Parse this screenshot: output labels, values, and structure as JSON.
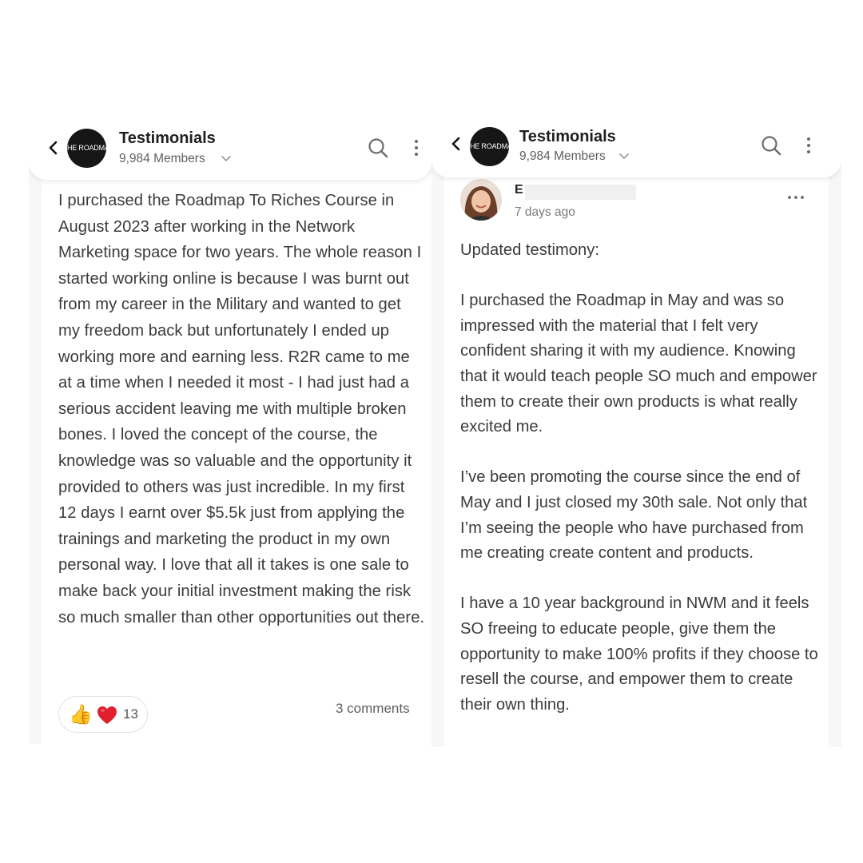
{
  "left": {
    "header": {
      "title": "Testimonials",
      "members": "9,984 Members",
      "logo_text": "HE ROADMA"
    },
    "post": {
      "body": "I purchased the Roadmap To Riches Course in August 2023 after working in the Network Marketing space for two years. The whole reason I started working online is because I was burnt out from my career in the Military and wanted to get my freedom back but unfortunately I ended up working more and earning less. R2R came to me at a time when I needed it most - I had just had a serious accident leaving me with multiple broken bones. I loved the concept of the course, the knowledge was so valuable and the opportunity it provided to others was just incredible. In my first 12 days I earnt over $5.5k just from applying the trainings and marketing the product in my own personal way. I love that all it takes is one sale to make back your initial investment making the risk so much smaller than other opportunities out there.",
      "reaction_icons": [
        "thumbs-up-icon",
        "heart-icon"
      ],
      "reaction_count": "13",
      "comments": "3 comments"
    }
  },
  "right": {
    "header": {
      "title": "Testimonials",
      "members": "9,984 Members",
      "logo_text": "HE ROADMA"
    },
    "post": {
      "author_visible": "E",
      "time": "7 days ago",
      "paragraphs": [
        "Updated testimony:",
        "I purchased the Roadmap in May and was so impressed with the material that I felt very confident sharing it with my audience. Knowing that it would teach people SO much and empower them to create their own products is what really excited me.",
        "I’ve been promoting the course since the end of May and I just closed my 30th sale. Not only that I’m seeing the people who have purchased from me creating create content and products.",
        "I have a 10 year background in NWM and it feels SO freeing to educate people, give them the opportunity to make 100% profits if they choose to resell the course, and empower them to create their own thing."
      ]
    }
  },
  "colors": {
    "heart": "#e0202f",
    "header_bg": "#ffffff",
    "panel_bg": "#f7f7f7",
    "logo_bg": "#161616"
  }
}
